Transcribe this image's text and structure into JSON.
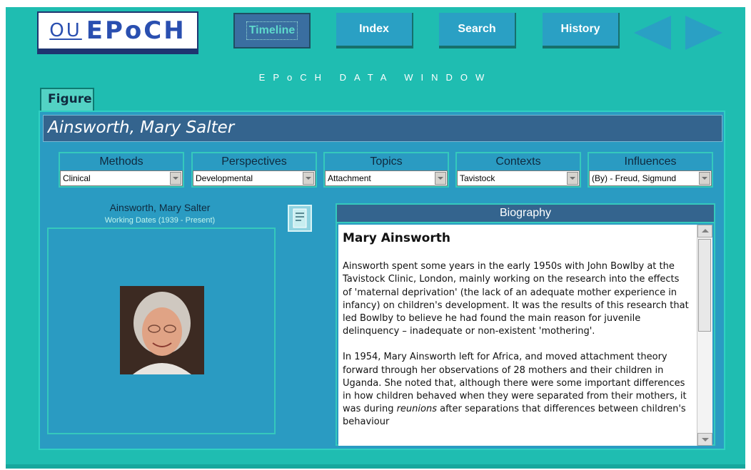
{
  "logo": {
    "ou": "OU",
    "epoch": "EPoCH"
  },
  "nav": {
    "timeline": "Timeline",
    "index": "Index",
    "search": "Search",
    "history": "History"
  },
  "window_title": "EPoCH DATA WINDOW",
  "tab": {
    "figure": "Figure"
  },
  "figure": {
    "name": "Ainsworth, Mary Salter",
    "working_dates": "Working Dates (1939 - Present)"
  },
  "categories": [
    {
      "label": "Methods",
      "selected": "Clinical"
    },
    {
      "label": "Perspectives",
      "selected": "Developmental"
    },
    {
      "label": "Topics",
      "selected": "Attachment"
    },
    {
      "label": "Contexts",
      "selected": "Tavistock"
    },
    {
      "label": "Influences",
      "selected": "(By) - Freud, Sigmund"
    }
  ],
  "biography": {
    "header": "Biography",
    "title": "Mary Ainsworth",
    "p1": "Ainsworth spent some years in the early 1950s with John Bowlby at the Tavistock Clinic, London, mainly working on the research into the effects of 'maternal deprivation' (the lack of an adequate mother experience in infancy) on children's development. It was the results of this research that led Bowlby to believe he had found the main reason for juvenile delinquency – inadequate or non-existent 'mothering'.",
    "p2_a": " In 1954, Mary Ainsworth left for Africa, and moved attachment theory forward through her observations of 28 mothers and their children in Uganda. She noted that, although there were some important differences in how children behaved when they were separated from their mothers, it was during ",
    "p2_em": "reunions",
    "p2_b": " after separations that differences between children's behaviour"
  },
  "colors": {
    "app_bg": "#1fbdb1",
    "panel_bg": "#2a9bc2",
    "header_bar": "#34648e",
    "nav_button": "#2aa0c4",
    "logo_text": "#2a4fb0"
  },
  "icons": [
    "prev-arrow-icon",
    "next-arrow-icon",
    "print-icon",
    "dropdown-arrow-icon"
  ]
}
